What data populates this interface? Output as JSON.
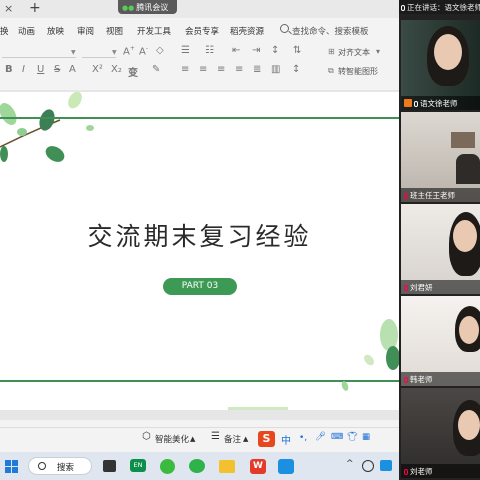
{
  "tabbar": {
    "close_glyph": "×",
    "new_tab_glyph": "+"
  },
  "meeting_pill": {
    "label": "腾讯会议"
  },
  "menu": {
    "items": [
      "换",
      "动画",
      "放映",
      "审阅",
      "视图",
      "开发工具",
      "会员专享",
      "稻壳资源"
    ],
    "search_placeholder": "查找命令、搜索模板"
  },
  "ribbon": {
    "align_text": "对齐文本",
    "smart_graphic": "转智能图形",
    "font_letters": [
      "B",
      "I",
      "U",
      "S",
      "A",
      "X²",
      "X₂",
      "A",
      "A"
    ]
  },
  "slide": {
    "title": "交流期末复习经验",
    "part_label": "PART 03"
  },
  "statusbar": {
    "beautify": "智能美化",
    "notes": "备注",
    "ime": "中"
  },
  "taskbar": {
    "search_label": "搜索",
    "en_badge": "EN"
  },
  "panel": {
    "speaking": "正在讲话：语文徐老师",
    "participants": [
      {
        "name": "语文徐老师"
      },
      {
        "name": "班主任王老师"
      },
      {
        "name": "刘君妍"
      },
      {
        "name": "韩老师"
      },
      {
        "name": "刘老师"
      }
    ]
  },
  "colors": {
    "accent_green": "#3f8f56",
    "pill_green": "#3d9a55",
    "meeting_dark": "#222222"
  }
}
